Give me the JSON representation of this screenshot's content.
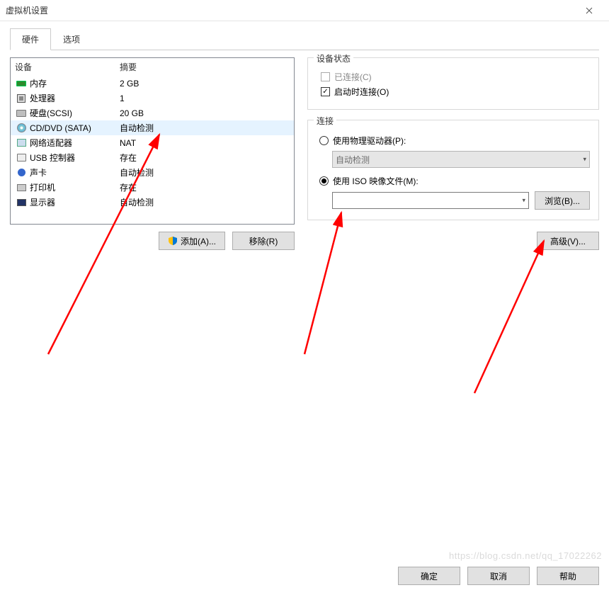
{
  "window": {
    "title": "虚拟机设置"
  },
  "tabs": {
    "hardware": "硬件",
    "options": "选项"
  },
  "device_list": {
    "header_device": "设备",
    "header_summary": "摘要",
    "rows": [
      {
        "name": "内存",
        "summary": "2 GB",
        "icon": "mem"
      },
      {
        "name": "处理器",
        "summary": "1",
        "icon": "cpu"
      },
      {
        "name": "硬盘(SCSI)",
        "summary": "20 GB",
        "icon": "hdd"
      },
      {
        "name": "CD/DVD (SATA)",
        "summary": "自动检测",
        "icon": "cd"
      },
      {
        "name": "网络适配器",
        "summary": "NAT",
        "icon": "net"
      },
      {
        "name": "USB 控制器",
        "summary": "存在",
        "icon": "usb"
      },
      {
        "name": "声卡",
        "summary": "自动检测",
        "icon": "snd"
      },
      {
        "name": "打印机",
        "summary": "存在",
        "icon": "prn"
      },
      {
        "name": "显示器",
        "summary": "自动检测",
        "icon": "dsp"
      }
    ]
  },
  "left_buttons": {
    "add": "添加(A)...",
    "remove": "移除(R)"
  },
  "device_status": {
    "legend": "设备状态",
    "connected": "已连接(C)",
    "connect_at_poweron": "启动时连接(O)"
  },
  "connection": {
    "legend": "连接",
    "use_physical": "使用物理驱动器(P):",
    "physical_value": "自动检测",
    "use_iso": "使用 ISO 映像文件(M):",
    "iso_path": "",
    "browse": "浏览(B)..."
  },
  "advanced": "高级(V)...",
  "footer": {
    "ok": "确定",
    "cancel": "取消",
    "help": "帮助"
  },
  "watermark": "https://blog.csdn.net/qq_17022262"
}
